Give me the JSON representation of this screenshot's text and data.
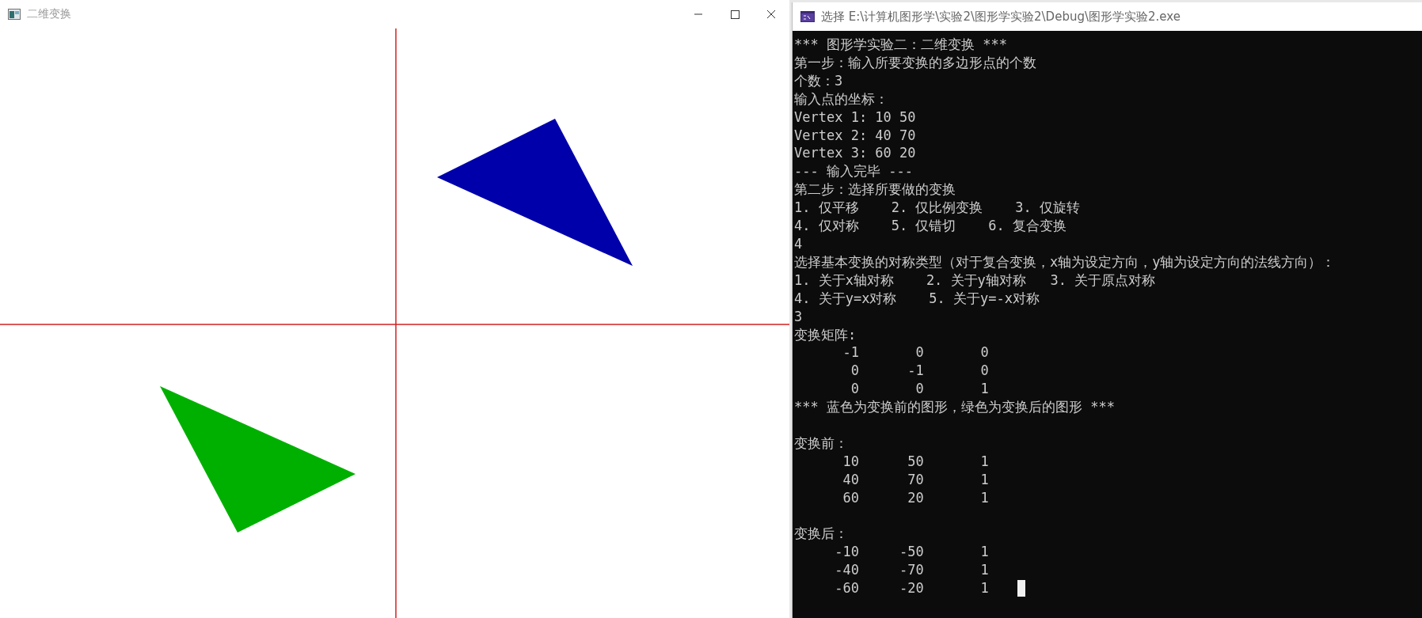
{
  "graphics_window": {
    "title": "二维变换",
    "triangles": [
      {
        "color": "#0000aa"
      },
      {
        "color": "#00b000"
      }
    ]
  },
  "console_window": {
    "title": "选择 E:\\计算机图形学\\实验2\\图形学实验2\\Debug\\图形学实验2.exe",
    "sections": [
      {
        "lines": [
          "*** 图形学实验二：二维变换 ***",
          "第一步：输入所要变换的多边形点的个数",
          "个数：3",
          "输入点的坐标：",
          "Vertex 1: 10 50",
          "Vertex 2: 40 70",
          "Vertex 3: 60 20",
          "--- 输入完毕 ---",
          "第二步：选择所要做的变换",
          "1. 仅平移    2. 仅比例变换    3. 仅旋转",
          "4. 仅对称    5. 仅错切    6. 复合变换",
          "4",
          "选择基本变换的对称类型（对于复合变换，x轴为设定方向，y轴为设定方向的法线方向）：",
          "1. 关于x轴对称    2. 关于y轴对称   3. 关于原点对称",
          "4. 关于y=x对称    5. 关于y=-x对称",
          "3",
          "变换矩阵:",
          "      -1       0       0",
          "       0      -1       0",
          "       0       0       1",
          "*** 蓝色为变换前的图形，绿色为变换后的图形 ***"
        ]
      },
      {
        "lines": [
          "变换前：",
          "      10      50       1",
          "      40      70       1",
          "      60      20       1"
        ]
      },
      {
        "lines": [
          "变换后：",
          "     -10     -50       1",
          "     -40     -70       1",
          "     -60     -20       1"
        ]
      }
    ]
  }
}
